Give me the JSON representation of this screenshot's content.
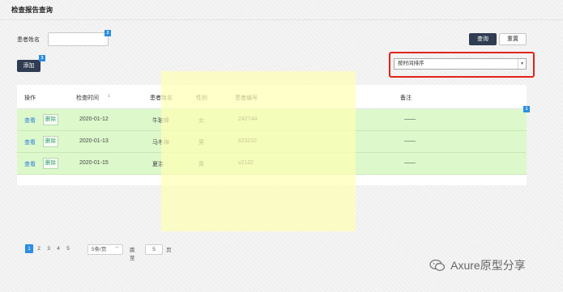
{
  "page": {
    "title": "检查报告查询"
  },
  "search": {
    "patient_name_label": "患者姓名",
    "patient_name_value": "",
    "marker_input": "2",
    "query_button": "查询",
    "reset_button": "重置"
  },
  "toolbar": {
    "add_button": "添加",
    "marker_add": "3"
  },
  "sort": {
    "selected": "按时间排序"
  },
  "table": {
    "marker": "1",
    "headers": {
      "action": "操作",
      "exam_time": "检查时间",
      "sort_indicator": "↕",
      "patient_name": "患者姓名",
      "gender": "性别",
      "patient_id": "患者编号",
      "remark": "备注"
    },
    "rows": [
      {
        "view": "查看",
        "delete": "删除",
        "time": "2020-01-12",
        "name": "牛玻峰",
        "gender": "女",
        "id": "242744",
        "remark": "——"
      },
      {
        "view": "查看",
        "delete": "删除",
        "time": "2020-01-13",
        "name": "马冬梅",
        "gender": "男",
        "id": "ti23232",
        "remark": "——"
      },
      {
        "view": "查看",
        "delete": "删除",
        "time": "2020-01-15",
        "name": "夏洛",
        "gender": "男",
        "id": "v2132",
        "remark": "——"
      }
    ]
  },
  "pagination": {
    "pages": [
      "1",
      "2",
      "3",
      "4",
      "5"
    ],
    "current": "1",
    "page_size": "5条/页",
    "goto_label": "跳至",
    "goto_value": "5",
    "page_unit": "页"
  },
  "watermark": {
    "text": "Axure原型分享"
  },
  "colors": {
    "accent": "#2b8de3",
    "row_highlight": "#ddf9cc",
    "overlay": "#ffffb4",
    "red_box": "#e2231a",
    "dark_button": "#2f3c52"
  }
}
